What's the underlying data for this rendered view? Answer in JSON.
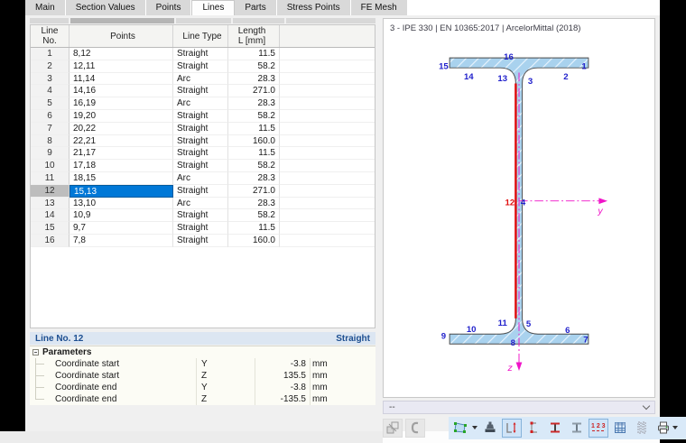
{
  "tabs": [
    {
      "label": "Main"
    },
    {
      "label": "Section Values"
    },
    {
      "label": "Points"
    },
    {
      "label": "Lines",
      "active": true
    },
    {
      "label": "Parts"
    },
    {
      "label": "Stress Points"
    },
    {
      "label": "FE Mesh"
    }
  ],
  "table": {
    "headers": {
      "no_l1": "Line",
      "no_l2": "No.",
      "points": "Points",
      "type": "Line Type",
      "len_l1": "Length",
      "len_l2": "L [mm]"
    },
    "rows": [
      {
        "no": "1",
        "points": "8,12",
        "type": "Straight",
        "length": "11.5"
      },
      {
        "no": "2",
        "points": "12,11",
        "type": "Straight",
        "length": "58.2"
      },
      {
        "no": "3",
        "points": "11,14",
        "type": "Arc",
        "length": "28.3"
      },
      {
        "no": "4",
        "points": "14,16",
        "type": "Straight",
        "length": "271.0"
      },
      {
        "no": "5",
        "points": "16,19",
        "type": "Arc",
        "length": "28.3"
      },
      {
        "no": "6",
        "points": "19,20",
        "type": "Straight",
        "length": "58.2"
      },
      {
        "no": "7",
        "points": "20,22",
        "type": "Straight",
        "length": "11.5"
      },
      {
        "no": "8",
        "points": "22,21",
        "type": "Straight",
        "length": "160.0"
      },
      {
        "no": "9",
        "points": "21,17",
        "type": "Straight",
        "length": "11.5"
      },
      {
        "no": "10",
        "points": "17,18",
        "type": "Straight",
        "length": "58.2"
      },
      {
        "no": "11",
        "points": "18,15",
        "type": "Arc",
        "length": "28.3"
      },
      {
        "no": "12",
        "points": "15,13",
        "type": "Straight",
        "length": "271.0",
        "selected": true
      },
      {
        "no": "13",
        "points": "13,10",
        "type": "Arc",
        "length": "28.3"
      },
      {
        "no": "14",
        "points": "10,9",
        "type": "Straight",
        "length": "58.2"
      },
      {
        "no": "15",
        "points": "9,7",
        "type": "Straight",
        "length": "11.5"
      },
      {
        "no": "16",
        "points": "7,8",
        "type": "Straight",
        "length": "160.0"
      }
    ]
  },
  "details": {
    "title": "Line No. 12",
    "type_label": "Straight",
    "group": "Parameters",
    "params": [
      {
        "label": "Coordinate start",
        "sym": "Y",
        "value": "-3.8",
        "unit": "mm"
      },
      {
        "label": "Coordinate start",
        "sym": "Z",
        "value": "135.5",
        "unit": "mm"
      },
      {
        "label": "Coordinate end",
        "sym": "Y",
        "value": "-3.8",
        "unit": "mm"
      },
      {
        "label": "Coordinate end",
        "sym": "Z",
        "value": "-135.5",
        "unit": "mm"
      }
    ]
  },
  "viewer": {
    "title": "3 - IPE 330 | EN 10365:2017 | ArcelorMittal (2018)",
    "combo_value": "--",
    "axes": {
      "y": "y",
      "z": "z"
    },
    "labels": [
      {
        "t": "15"
      },
      {
        "t": "16"
      },
      {
        "t": "1"
      },
      {
        "t": "14"
      },
      {
        "t": "13"
      },
      {
        "t": "3"
      },
      {
        "t": "2"
      },
      {
        "t": "12"
      },
      {
        "t": "4"
      },
      {
        "t": "11"
      },
      {
        "t": "5"
      },
      {
        "t": "10"
      },
      {
        "t": "6"
      },
      {
        "t": "9"
      },
      {
        "t": "7"
      },
      {
        "t": "8"
      }
    ]
  },
  "toolbar": {
    "numbering_glyph": "1 2 3",
    "icons": [
      "transfer",
      "section-profile",
      "render-view",
      "stamp-press",
      "dimension-lines",
      "stress-points",
      "section-dimensions",
      "section-plain",
      "numbering",
      "grid",
      "part-list",
      "print",
      "zoom-reset"
    ]
  },
  "colors": {
    "selection_blue": "#0078d7",
    "selected_line_red": "#e01010",
    "label_blue": "#2222cc",
    "axis_magenta": "#f013c8",
    "section_fill": "#a9d2ee"
  }
}
